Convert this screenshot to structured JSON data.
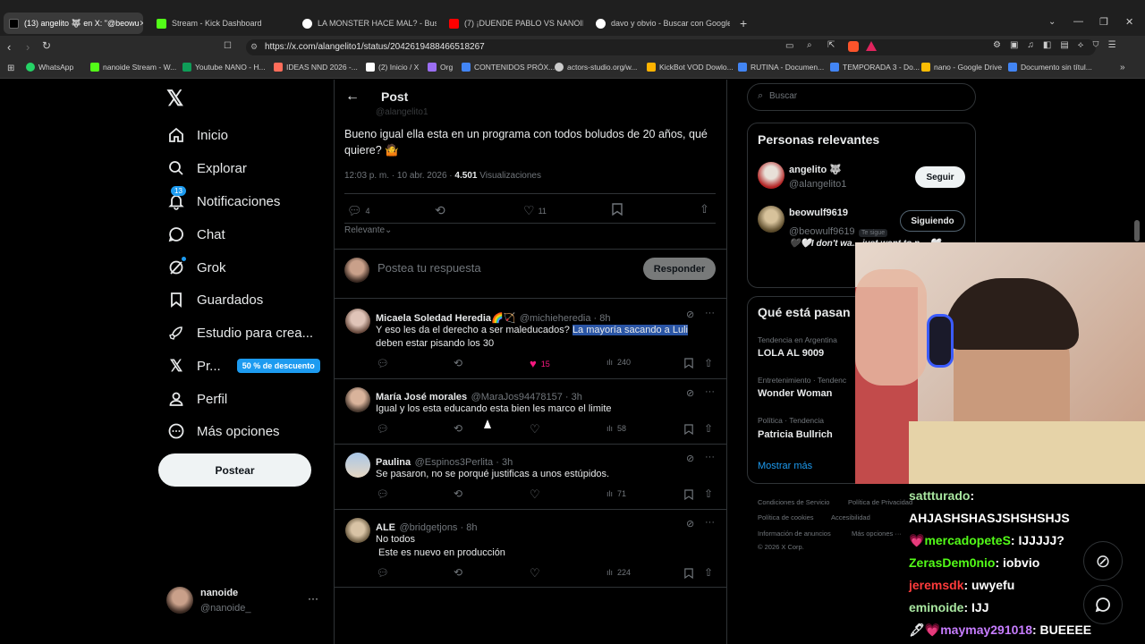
{
  "browser": {
    "tabs": [
      {
        "label": "(13) angelito 🐺 en X: \"@beowu",
        "active": true,
        "color": "#ffffff"
      },
      {
        "label": "Stream - Kick Dashboard",
        "color": "#53fc18"
      },
      {
        "label": "LA MONSTER HACE MAL? - Buscar c",
        "color": "#ffffff"
      },
      {
        "label": "(7) ¡DUENDE PABLO VS NANOIDE! S",
        "color": "#ff0000"
      },
      {
        "label": "davo y obvio - Buscar con Google",
        "color": "#ffffff"
      }
    ],
    "new_tab": "+",
    "url": "https://x.com/alangelito1/status/2042619488466518267",
    "bookmarks": [
      {
        "label": "WhatsApp",
        "color": "#25d366"
      },
      {
        "label": "nanoide Stream - W...",
        "color": "#53fc18"
      },
      {
        "label": "Youtube NANO - H...",
        "color": "#0f9d58"
      },
      {
        "label": "IDEAS NND 2026 -...",
        "color": "#ff6d5a"
      },
      {
        "label": "(2) Inicio / X",
        "color": "#ffffff"
      },
      {
        "label": "Org",
        "color": "#9b6ef3"
      },
      {
        "label": "CONTENIDOS PRÓX...",
        "color": "#4285f4"
      },
      {
        "label": "actors-studio.org/w...",
        "color": "#cccccc"
      },
      {
        "label": "KickBot VOD Dowlo...",
        "color": "#ffb300"
      },
      {
        "label": "RUTINA - Documen...",
        "color": "#4285f4"
      },
      {
        "label": "TEMPORADA 3 - Do...",
        "color": "#4285f4"
      },
      {
        "label": "nano - Google Drive",
        "color": "#fbbc04"
      },
      {
        "label": "Documento sin títul...",
        "color": "#4285f4"
      }
    ]
  },
  "sidebar": {
    "logo": "𝕏",
    "items": [
      {
        "label": "Inicio",
        "icon": "home-icon"
      },
      {
        "label": "Explorar",
        "icon": "search-icon"
      },
      {
        "label": "Notificaciones",
        "icon": "bell-icon",
        "badge": "13"
      },
      {
        "label": "Chat",
        "icon": "chat-icon"
      },
      {
        "label": "Grok",
        "icon": "grok-icon"
      },
      {
        "label": "Guardados",
        "icon": "bookmark-icon"
      },
      {
        "label": "Estudio para crea...",
        "icon": "rocket-icon"
      },
      {
        "label": "Pr...",
        "icon": "x-icon",
        "promo": "50 % de descuento"
      },
      {
        "label": "Perfil",
        "icon": "person-icon"
      },
      {
        "label": "Más opciones",
        "icon": "more-circle-icon"
      }
    ],
    "post_button": "Postear",
    "account": {
      "name": "nanoide",
      "handle": "@nanoide_",
      "more": "···"
    }
  },
  "post": {
    "header_title": "Post",
    "partial_handle": "@alangelito1",
    "text": "Bueno igual ella esta en un programa con todos boludos de 20 años, qué quiere? 🤷",
    "time": "12:03 p. m. · 10 abr. 2026 · ",
    "views_count": "4.501",
    "views_label": "Visualizaciones",
    "replies": "4",
    "likes": "11",
    "sort": "Relevante",
    "reply_placeholder": "Postea tu respuesta",
    "reply_button": "Responder"
  },
  "replies": [
    {
      "name": "Micaela Soledad Heredia🌈🏹",
      "handle": "@michieheredia · 8h",
      "text_before": "Y eso les da el derecho a ser maleducados? ",
      "text_highlight": "La mayoría sacando a Luli",
      "text_after": " deben estar pisando los 30",
      "likes": "15",
      "views": "240",
      "liked": true
    },
    {
      "name": "María José morales",
      "handle": "@MaraJos94478157 · 3h",
      "text": "Igual y los esta educando esta bien les marco el limite",
      "likes": "",
      "views": "58"
    },
    {
      "name": "Paulina",
      "handle": "@Espinos3Perlita · 3h",
      "text": "Se pasaron, no se porqué justificas a unos estúpidos.",
      "likes": "",
      "views": "71"
    },
    {
      "name": "ALE",
      "handle": "@bridgetjons · 8h",
      "text": "No todos",
      "text2": " Este es nuevo en producción",
      "likes": "",
      "views": "224"
    }
  ],
  "right": {
    "search_placeholder": "Buscar",
    "relevant_title": "Personas relevantes",
    "people": [
      {
        "name": "angelito 🐺",
        "handle": "@alangelito1",
        "button": "Seguir"
      },
      {
        "name": "beowulf9619",
        "handle": "@beowulf9619",
        "follows_you": "Te sigue",
        "button": "Siguiendo",
        "bio": "🖤🤍I don't wa... just want to n... 🤍"
      }
    ],
    "trends_title": "Qué está pasan",
    "trends": [
      {
        "context": "Tendencia en Argentina",
        "name": "LOLA AL 9009"
      },
      {
        "context": "Entretenimiento · Tendenc",
        "name": "Wonder Woman"
      },
      {
        "context": "Política · Tendencia",
        "name": "Patricia Bullrich"
      }
    ],
    "show_more": "Mostrar más",
    "footer": [
      "Condiciones de Servicio",
      "Política de Privacidad",
      "Política de cookies",
      "Accesibilidad",
      "Información de anuncios",
      "Más opciones ···",
      "© 2026 X Corp."
    ]
  },
  "stream_chat": [
    {
      "user": "sattturado",
      "msg": "",
      "color": "#a8e6a0",
      "badge": ""
    },
    {
      "user": "",
      "msg": "AHJASHSHASJSHSHSHJS",
      "color": "#ffffff",
      "badge": ""
    },
    {
      "user": "mercadopeteS",
      "msg": "IJJJJJ?",
      "color": "#53fc18",
      "badge": "💗"
    },
    {
      "user": "ZerasDem0nio",
      "msg": "iobvio",
      "color": "#53fc18",
      "badge": ""
    },
    {
      "user": "jeremsdk",
      "msg": "uwyefu",
      "color": "#ff3b3b",
      "badge": ""
    },
    {
      "user": "eminoide",
      "msg": "IJJ",
      "color": "#a8e6a0",
      "badge": ""
    },
    {
      "user": "maymay291018",
      "msg": "BUEEEE",
      "color": "#c77dff",
      "badge": "🖋💗"
    }
  ],
  "colors": {
    "accent": "#1d9bf0",
    "like": "#f91880",
    "bg": "#000000",
    "border": "#2f3336",
    "muted": "#71767b"
  }
}
